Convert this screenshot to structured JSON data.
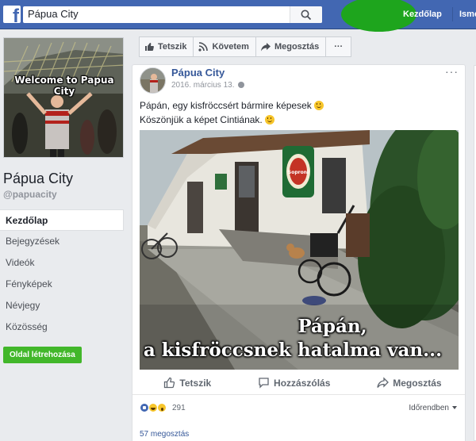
{
  "topbar": {
    "search_value": "Pápua City",
    "nav_home": "Kezdőlap",
    "nav_find": "Ismerősök keresése"
  },
  "page": {
    "cover_text": "Welcome to Papua City",
    "name": "Pápua City",
    "handle": "@papuacity",
    "create_page_label": "Oldal létrehozása"
  },
  "sidebar": {
    "items": [
      {
        "label": "Kezdőlap"
      },
      {
        "label": "Bejegyzések"
      },
      {
        "label": "Videók"
      },
      {
        "label": "Fényképek"
      },
      {
        "label": "Névjegy"
      },
      {
        "label": "Közösség"
      }
    ]
  },
  "actions": {
    "like": "Tetszik",
    "follow": "Követem",
    "share": "Megosztás",
    "more": "···"
  },
  "post": {
    "author": "Pápua City",
    "date": "2016. március 13.",
    "line1": "Pápán, egy kisfröccsért bármire képesek",
    "line2": "Köszönjük a képet Cintiának.",
    "caption_line1": "Pápán,",
    "caption_line2": "a kisfröccsnek hatalma van...",
    "sign_text": "Soproni",
    "like_label": "Tetszik",
    "comment_label": "Hozzászólás",
    "share_label": "Megosztás",
    "reaction_count": "291",
    "sort_label": "Időrendben",
    "shares_label": "57 megosztás"
  },
  "colors": {
    "brand": "#4267b2",
    "green_button": "#42b72a",
    "link": "#365899"
  }
}
